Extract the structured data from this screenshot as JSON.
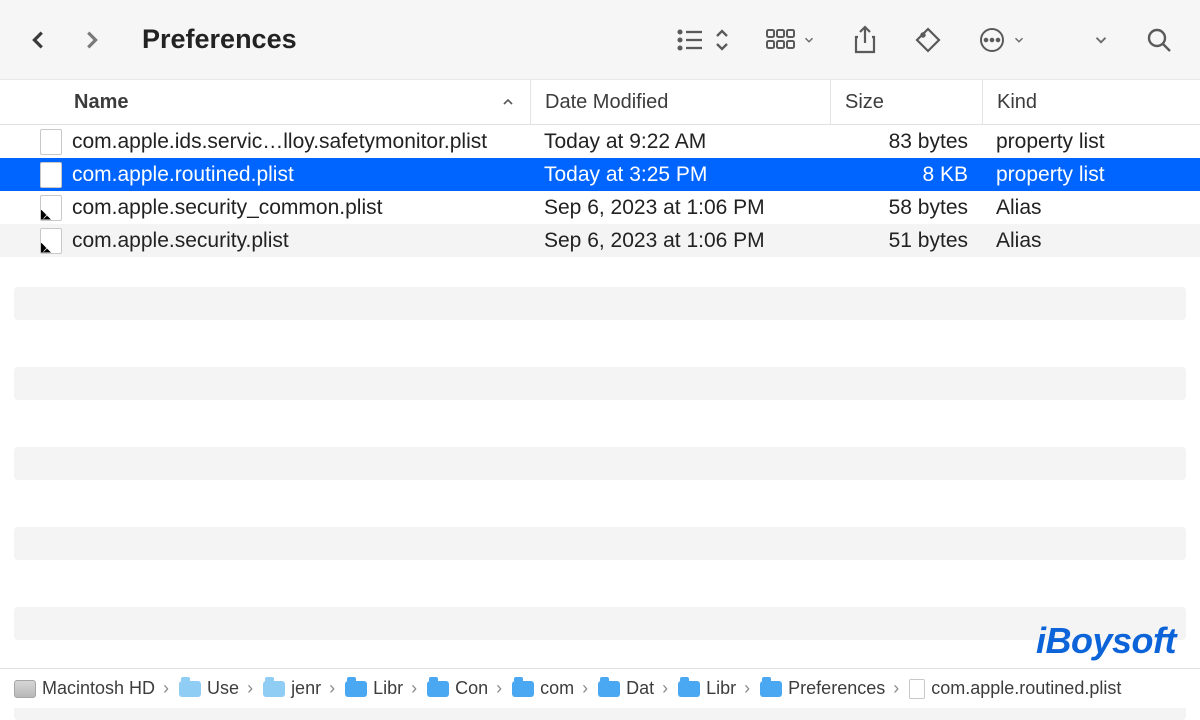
{
  "window": {
    "title": "Preferences"
  },
  "columns": {
    "name": "Name",
    "date": "Date Modified",
    "size": "Size",
    "kind": "Kind"
  },
  "files": [
    {
      "name": "com.apple.ids.servic…lloy.safetymonitor.plist",
      "date": "Today at 9:22 AM",
      "size": "83 bytes",
      "kind": "property list",
      "selected": false,
      "iconType": "plist"
    },
    {
      "name": "com.apple.routined.plist",
      "date": "Today at 3:25 PM",
      "size": "8 KB",
      "kind": "property list",
      "selected": true,
      "iconType": "plist"
    },
    {
      "name": "com.apple.security_common.plist",
      "date": "Sep 6, 2023 at 1:06 PM",
      "size": "58 bytes",
      "kind": "Alias",
      "selected": false,
      "iconType": "alias"
    },
    {
      "name": "com.apple.security.plist",
      "date": "Sep 6, 2023 at 1:06 PM",
      "size": "51 bytes",
      "kind": "Alias",
      "selected": false,
      "iconType": "alias"
    }
  ],
  "path": [
    {
      "label": "Macintosh HD",
      "iconType": "drive"
    },
    {
      "label": "Use",
      "iconType": "folder-light"
    },
    {
      "label": "jenr",
      "iconType": "folder-light"
    },
    {
      "label": "Libr",
      "iconType": "folder"
    },
    {
      "label": "Con",
      "iconType": "folder"
    },
    {
      "label": "com",
      "iconType": "folder"
    },
    {
      "label": "Dat",
      "iconType": "folder"
    },
    {
      "label": "Libr",
      "iconType": "folder"
    },
    {
      "label": "Preferences",
      "iconType": "folder"
    },
    {
      "label": "com.apple.routined.plist",
      "iconType": "doc"
    }
  ],
  "watermark": "iBoysoft"
}
